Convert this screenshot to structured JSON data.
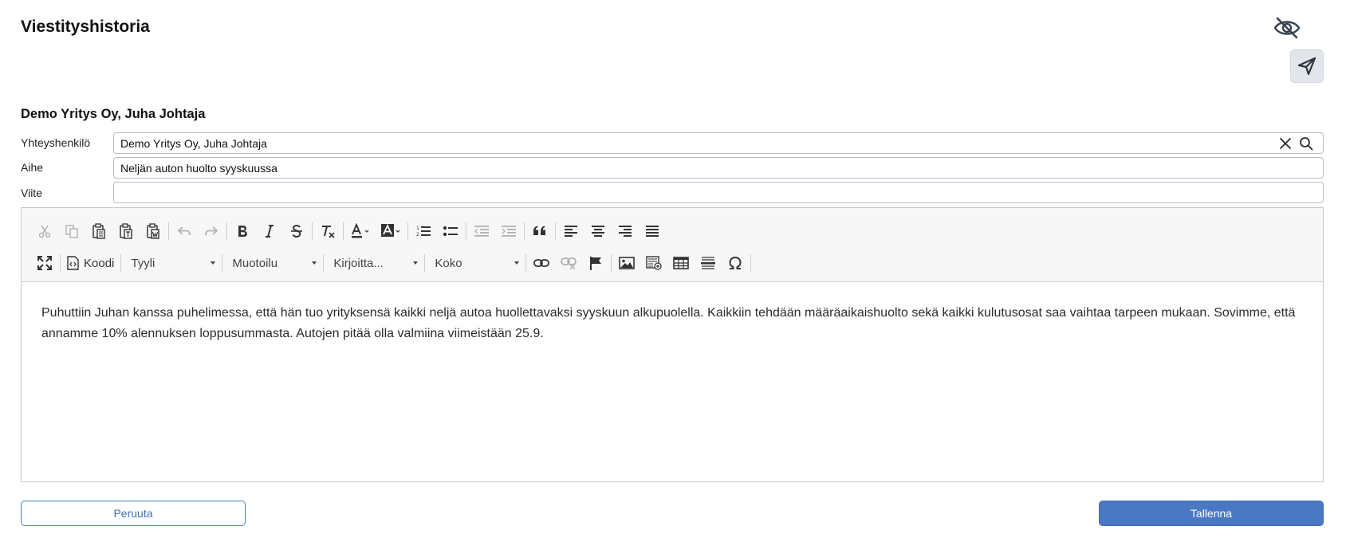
{
  "header": {
    "title": "Viestityshistoria",
    "hide_icon": "eye-off-icon",
    "send_icon": "paper-plane-icon"
  },
  "contact_heading": "Demo Yritys Oy, Juha Johtaja",
  "form": {
    "contact": {
      "label": "Yhteyshenkilö",
      "value": "Demo Yritys Oy, Juha Johtaja"
    },
    "subject": {
      "label": "Aihe",
      "value": "Neljän auton huolto syyskuussa"
    },
    "reference": {
      "label": "Viite",
      "value": ""
    }
  },
  "toolbar": {
    "source_label": "Koodi",
    "style_combo": "Tyyli",
    "format_combo": "Muotoilu",
    "font_combo": "Kirjoitta...",
    "size_combo": "Koko"
  },
  "editor": {
    "content": "Puhuttiin Juhan kanssa puhelimessa, että hän tuo yrityksensä kaikki neljä autoa huollettavaksi syyskuun alkupuolella. Kaikkiin tehdään määräaikaishuolto sekä kaikki kulutusosat saa vaihtaa tarpeen mukaan. Sovimme, että annamme 10% alennuksen loppusummasta. Autojen pitää olla valmiina viimeistään 25.9."
  },
  "actions": {
    "cancel_label": "Peruuta",
    "save_label": "Tallenna"
  },
  "colors": {
    "primary": "#4a78c2",
    "toolbar_bg": "#f7f7f7"
  }
}
